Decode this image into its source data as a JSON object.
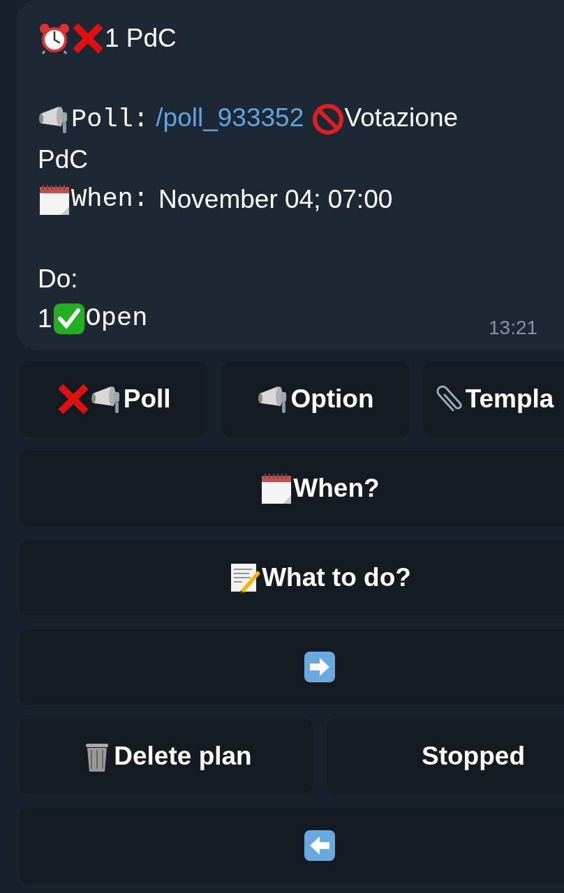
{
  "message": {
    "heading": "1 PdC",
    "poll_label": "Poll:",
    "poll_link": "/poll_933352",
    "poll_title": "Votazione PdC",
    "when_label": "When:",
    "when_value": "November 04; 07:00",
    "do_label": "Do:",
    "do_number": "1",
    "do_text": "Open",
    "time": "13:21"
  },
  "keyboard": [
    [
      {
        "kind": "text",
        "label": "Poll"
      },
      {
        "kind": "text",
        "label": "Option"
      },
      {
        "kind": "text",
        "label": "Templa"
      }
    ],
    [
      {
        "kind": "text",
        "label": "When?"
      }
    ],
    [
      {
        "kind": "text",
        "label": "What to do?"
      }
    ],
    [
      {
        "kind": "forward"
      }
    ],
    [
      {
        "kind": "text",
        "label": "Delete plan"
      },
      {
        "kind": "text",
        "label": "Stopped"
      }
    ],
    [
      {
        "kind": "back"
      }
    ]
  ]
}
